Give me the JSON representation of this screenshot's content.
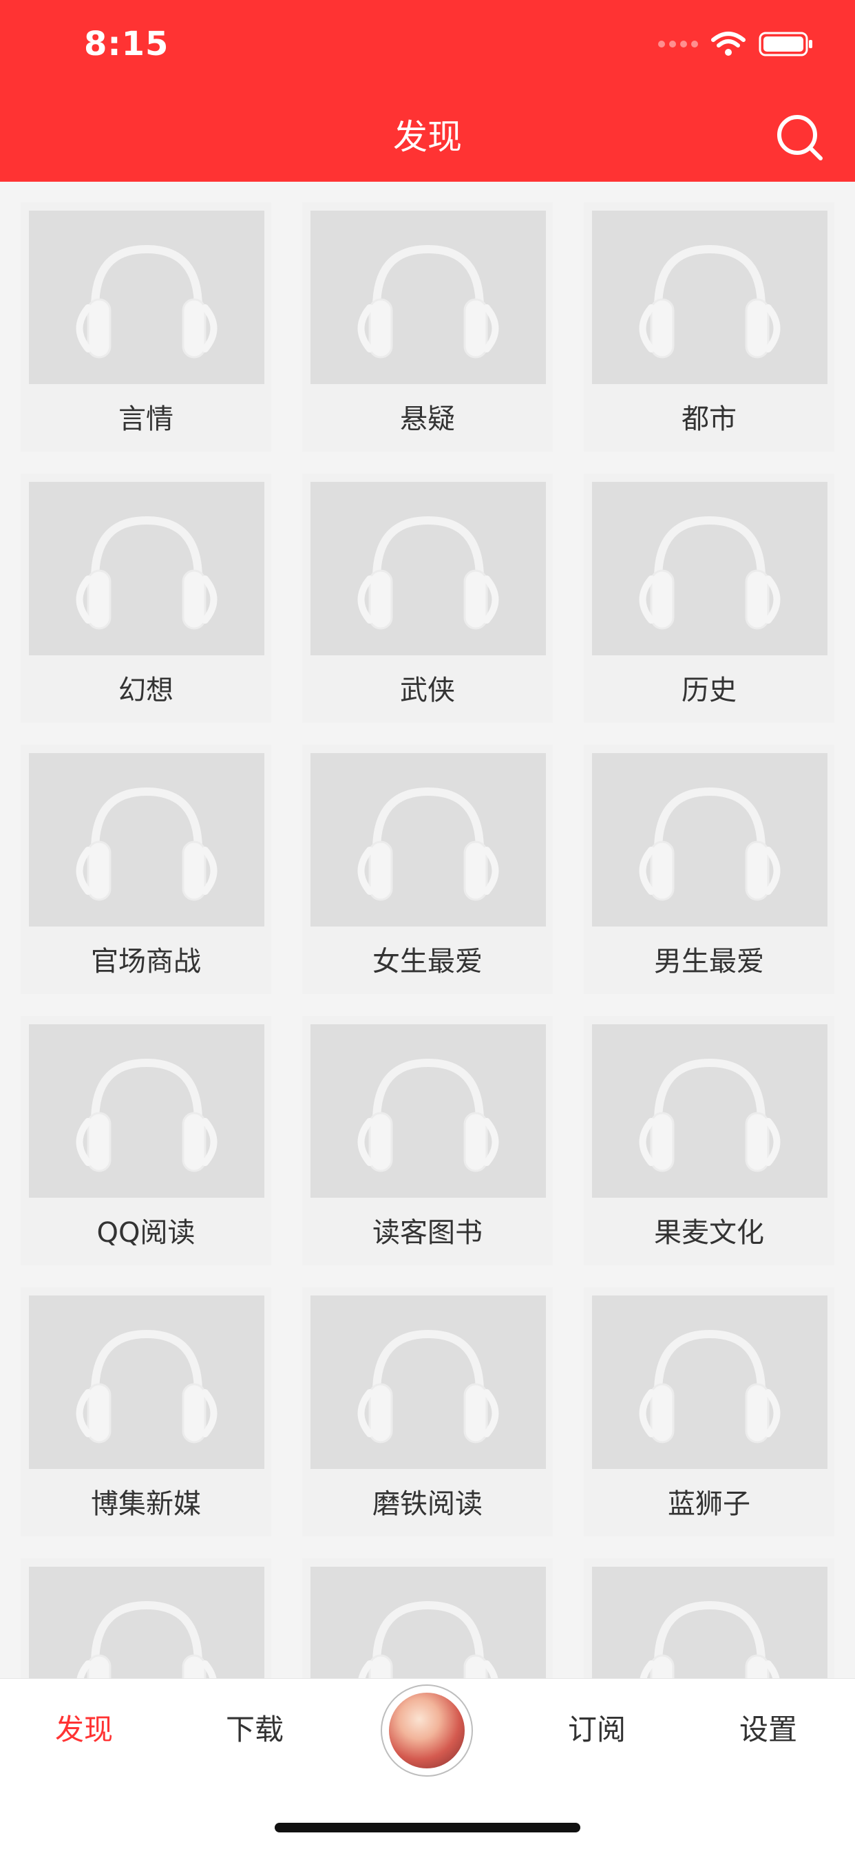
{
  "status_bar": {
    "time": "8:15"
  },
  "header": {
    "title": "发现"
  },
  "categories": [
    "言情",
    "悬疑",
    "都市",
    "幻想",
    "武侠",
    "历史",
    "官场商战",
    "女生最爱",
    "男生最爱",
    "QQ阅读",
    "读客图书",
    "果麦文化",
    "博集新媒",
    "磨铁阅读",
    "蓝狮子",
    "",
    "",
    ""
  ],
  "tabbar": {
    "tabs": [
      "发现",
      "下载",
      "订阅",
      "设置"
    ],
    "active": "发现"
  },
  "colors": {
    "accent": "#ff3333",
    "tile_bg": "#f1f1f1",
    "image_bg": "#dedede"
  },
  "icons": {
    "search": "search-icon",
    "tile_placeholder": "headphones-icon",
    "wifi": "wifi-icon",
    "battery": "battery-icon"
  }
}
